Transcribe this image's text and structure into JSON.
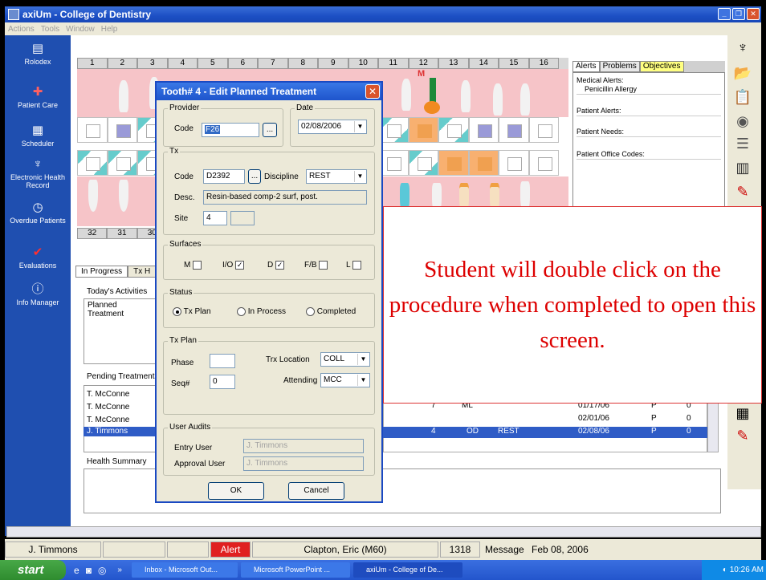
{
  "window": {
    "title": "axiUm - College of Dentistry"
  },
  "menu": [
    "Actions",
    "Tools",
    "Window",
    "Help"
  ],
  "nav": [
    {
      "label": "Rolodex",
      "icon": "rolodex-icon"
    },
    {
      "label": "Patient Care",
      "icon": "patient-care-icon"
    },
    {
      "label": "Scheduler",
      "icon": "scheduler-icon"
    },
    {
      "label": "Electronic Health Record",
      "icon": "tooth-record-icon"
    },
    {
      "label": "Overdue Patients",
      "icon": "overdue-clock-icon"
    },
    {
      "label": "Evaluations",
      "icon": "evaluation-check-icon"
    },
    {
      "label": "Info Manager",
      "icon": "info-icon"
    }
  ],
  "chart": {
    "upper_numbers": [
      "1",
      "2",
      "3",
      "4",
      "5",
      "6",
      "7",
      "8",
      "9",
      "10",
      "11",
      "12",
      "13",
      "14",
      "15",
      "16"
    ],
    "lower_numbers": [
      "32",
      "31",
      "30"
    ],
    "marker": "M"
  },
  "alerts": {
    "tabs": [
      "Alerts",
      "Problems",
      "Objectives"
    ],
    "medical_label": "Medical Alerts:",
    "medical_value": "Penicillin Allergy",
    "patient_alerts": "Patient Alerts:",
    "patient_needs": "Patient Needs:",
    "office_codes": "Patient Office Codes:"
  },
  "lower": {
    "tabs": [
      "In Progress",
      "Tx H"
    ],
    "todays_activities": "Today's Activities",
    "planned_treatment": "Planned Treatment",
    "pending_treatments": "Pending Treatments",
    "pending_rows": [
      "T. McConne",
      "T. McConne",
      "T. McConne",
      "J. Timmons"
    ],
    "health_summary": "Health Summary",
    "grid_rows": [
      {
        "a": "7",
        "b": "ML",
        "c": "",
        "date": "01/17/06",
        "status": "P",
        "n": "0"
      },
      {
        "a": "",
        "b": "",
        "c": "",
        "date": "02/01/06",
        "status": "P",
        "n": "0"
      },
      {
        "a": "4",
        "b": "OD",
        "c": "REST",
        "date": "02/08/06",
        "status": "P",
        "n": "0"
      }
    ]
  },
  "dialog": {
    "title": "Tooth# 4 - Edit Planned Treatment",
    "provider_group": "Provider",
    "code_label": "Code",
    "provider_code": "F26",
    "date_group": "Date",
    "date_value": "02/08/2006",
    "tx_group": "Tx",
    "tx_code": "D2392",
    "discipline_label": "Discipline",
    "discipline_value": "REST",
    "desc_label": "Desc.",
    "desc_value": "Resin-based comp-2 surf, post.",
    "site_label": "Site",
    "site_value": "4",
    "surfaces_group": "Surfaces",
    "surfaces": [
      {
        "label": "M",
        "checked": false
      },
      {
        "label": "I/O",
        "checked": true
      },
      {
        "label": "D",
        "checked": true
      },
      {
        "label": "F/B",
        "checked": false
      },
      {
        "label": "L",
        "checked": false
      }
    ],
    "status_group": "Status",
    "status_options": [
      "Tx Plan",
      "In Process",
      "Completed"
    ],
    "txplan_group": "Tx Plan",
    "phase_label": "Phase",
    "phase_value": "",
    "seq_label": "Seq#",
    "seq_value": "0",
    "trx_location_label": "Trx Location",
    "trx_location_value": "COLL",
    "attending_label": "Attending",
    "attending_value": "MCC",
    "audits_group": "User Audits",
    "entry_user_label": "Entry User",
    "entry_user_value": "J. Timmons",
    "approval_user_label": "Approval User",
    "approval_user_value": "J. Timmons",
    "ok_label": "OK",
    "cancel_label": "Cancel"
  },
  "callout": {
    "text": "Student will double click on the procedure when completed to open this screen.",
    "color": "#dd0000"
  },
  "status_bar": {
    "user": "J. Timmons",
    "alert": "Alert",
    "patient": "Clapton, Eric (M60)",
    "number": "1318",
    "message": "Message",
    "date": "Feb 08, 2006"
  },
  "taskbar": {
    "start": "start",
    "tasks": [
      "Inbox - Microsoft Out...",
      "Microsoft PowerPoint ...",
      "axiUm - College of De..."
    ],
    "clock": "10:26 AM"
  }
}
